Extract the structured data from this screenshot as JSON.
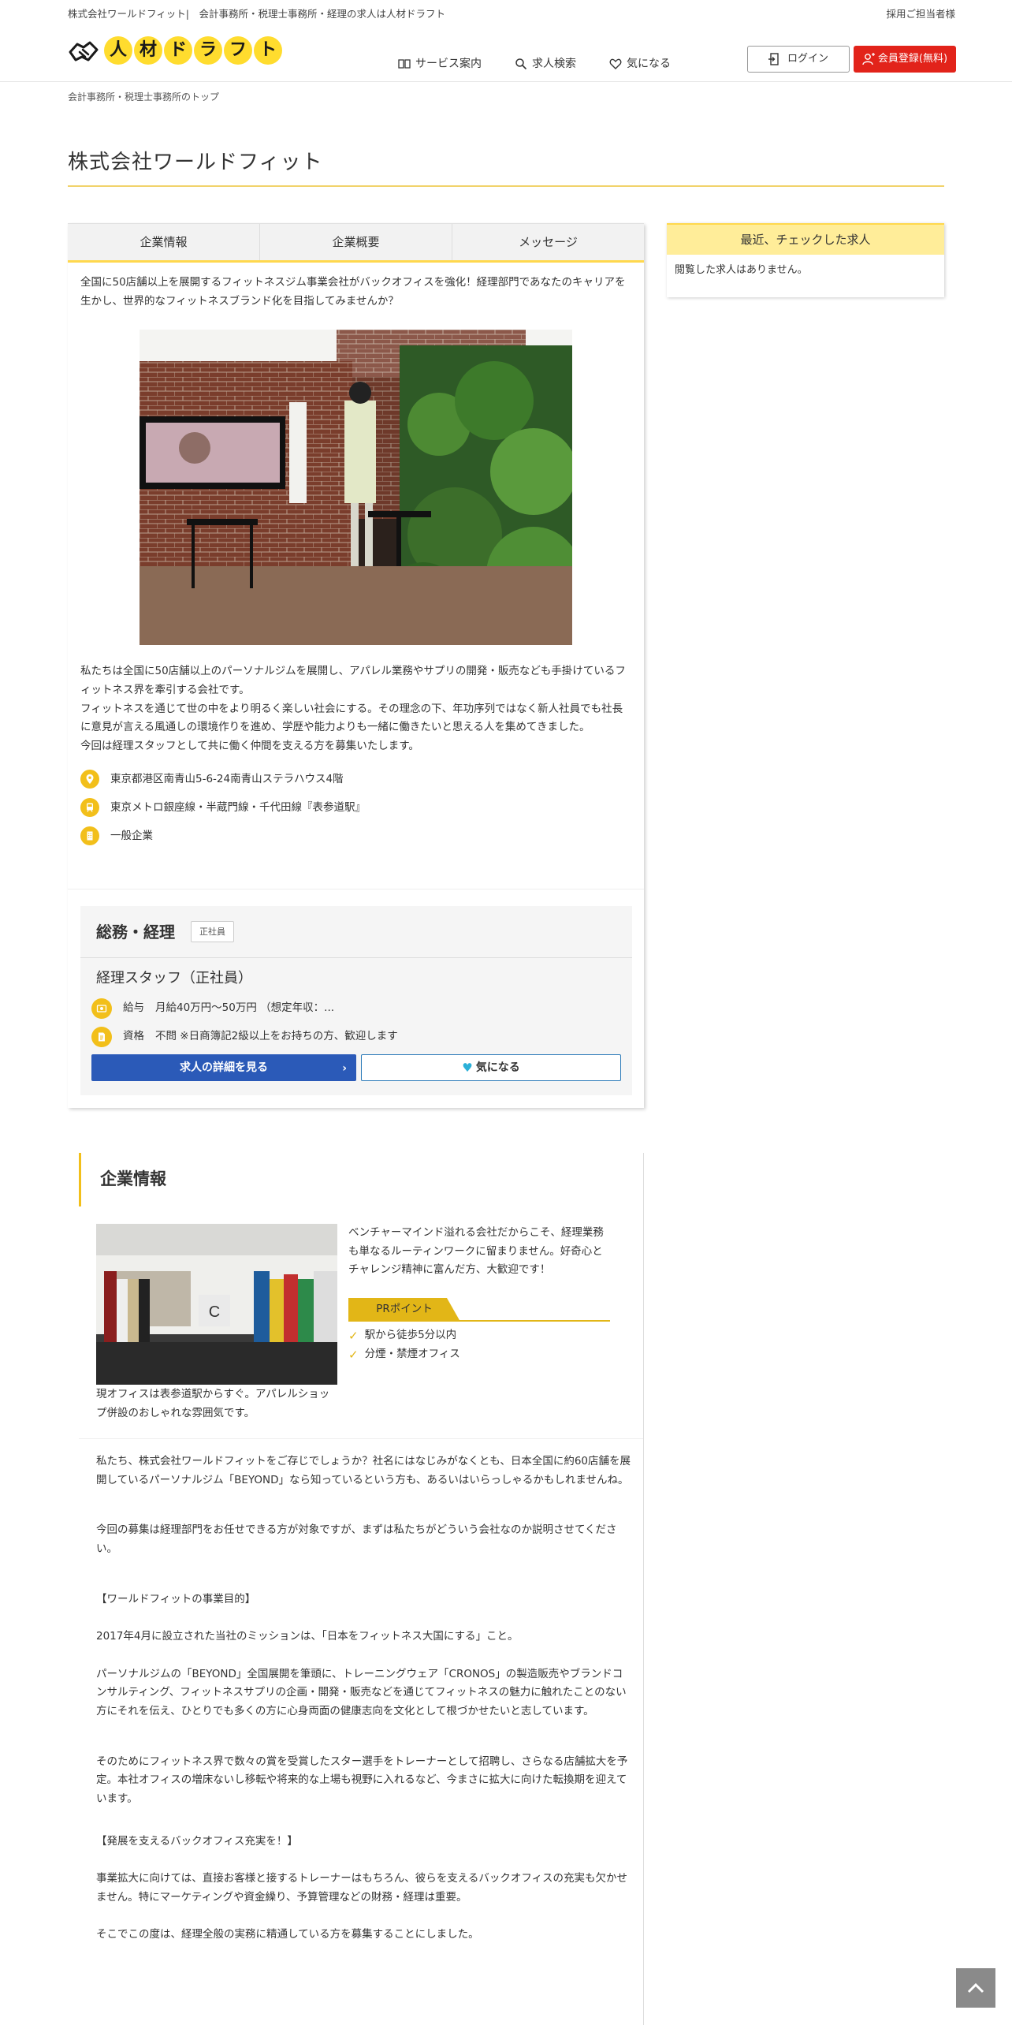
{
  "topbar": {
    "site_desc": "株式会社ワールドフィット|　会計事務所・税理士事務所・経理の求人は人材ドラフト",
    "recruiter_link": "採用ご担当者様"
  },
  "logo": {
    "chars": [
      "人",
      "材",
      "ド",
      "ラ",
      "フ",
      "ト"
    ],
    "color": "#ffdc2e"
  },
  "nav": {
    "service": "サービス案内",
    "search": "求人検索",
    "favorite": "気になる"
  },
  "header": {
    "login": "ログイン",
    "register": "会員登録(無料)",
    "register_color": "#e2231a"
  },
  "breadcrumb": "会計事務所・税理士事務所のトップ",
  "company_name": "株式会社ワールドフィット",
  "tabs": [
    "企業情報",
    "企業概要",
    "メッセージ"
  ],
  "intro": "全国に50店舗以上を展開するフィットネスジム事業会社がバックオフィスを強化！経理部門であなたのキャリアを生かし、世界的なフィットネスブランド化を目指してみませんか？",
  "description": [
    "私たちは全国に50店舗以上のパーソナルジムを展開し、アパレル業務やサプリの開発・販売なども手掛けているフィットネス界を牽引する会社です。",
    "フィットネスを通じて世の中をより明るく楽しい社会にする。その理念の下、年功序列ではなく新人社員でも社長に意見が言える風通しの環境作りを進め、学歴や能力よりも一緒に働きたいと思える人を集めてきました。",
    "今回は経理スタッフとして共に働く仲間を支える方を募集いたします。"
  ],
  "info": {
    "address": "東京都港区南青山5-6-24南青山ステラハウス4階",
    "station": "東京メトロ銀座線・半蔵門線・千代田線『表参道駅』",
    "type": "一般企業"
  },
  "job": {
    "category": "総務・経理",
    "employment_tag": "正社員",
    "title": "経理スタッフ（正社員）",
    "salary_label": "給与",
    "salary": "月給40万円～50万円 （想定年収：...",
    "qualification_label": "資格",
    "qualification": "不問 ※日商簿記2級以上をお持ちの方、歓迎します",
    "detail_button": "求人の詳細を見る",
    "favorite_button": "気になる"
  },
  "sidebar": {
    "title": "最近、チェックした求人",
    "empty": "閲覧した求人はありません。"
  },
  "company_info": {
    "heading": "企業情報",
    "pr_text": "ベンチャーマインド溢れる会社だからこそ、経理業務も単なるルーティンワークに留まりません。好奇心とチャレンジ精神に富んだ方、大歓迎です！",
    "pr_label": "PRポイント",
    "pr_points": [
      "駅から徒歩5分以内",
      "分煙・禁煙オフィス"
    ],
    "photo_caption": "現オフィスは表参道駅からすぐ。アパレルショップ併設のおしゃれな雰囲気です。"
  },
  "body": [
    "私たち、株式会社ワールドフィットをご存じでしょうか？社名にはなじみがなくとも、日本全国に約60店舗を展開しているパーソナルジム「BEYOND」なら知っているという方も、あるいはいらっしゃるかもしれませんね。",
    "今回の募集は経理部門をお任せできる方が対象ですが、まずは私たちがどういう会社なのか説明させてください。",
    "【ワールドフィットの事業目的】",
    "2017年4月に設立された当社のミッションは、「日本をフィットネス大国にする」こと。",
    "パーソナルジムの「BEYOND」全国展開を筆頭に、トレーニングウェア「CRONOS」の製造販売やブランドコンサルティング、フィットネスサプリの企画・開発・販売などを通じてフィットネスの魅力に触れたことのない方にそれを伝え、ひとりでも多くの方に心身両面の健康志向を文化として根づかせたいと志しています。",
    "そのためにフィットネス界で数々の賞を受賞したスター選手をトレーナーとして招聘し、さらなる店舗拡大を予定。本社オフィスの増床ないし移転や将来的な上場も視野に入れるなど、今まさに拡大に向けた転換期を迎えています。",
    "【発展を支えるバックオフィス充実を！】",
    "事業拡大に向けては、直接お客様と接するトレーナーはもちろん、彼らを支えるバックオフィスの充実も欠かせません。特にマーケティングや資金繰り、予算管理などの財務・経理は重要。",
    "そこでこの度は、経理全般の実務に精通している方を募集することにしました。"
  ]
}
